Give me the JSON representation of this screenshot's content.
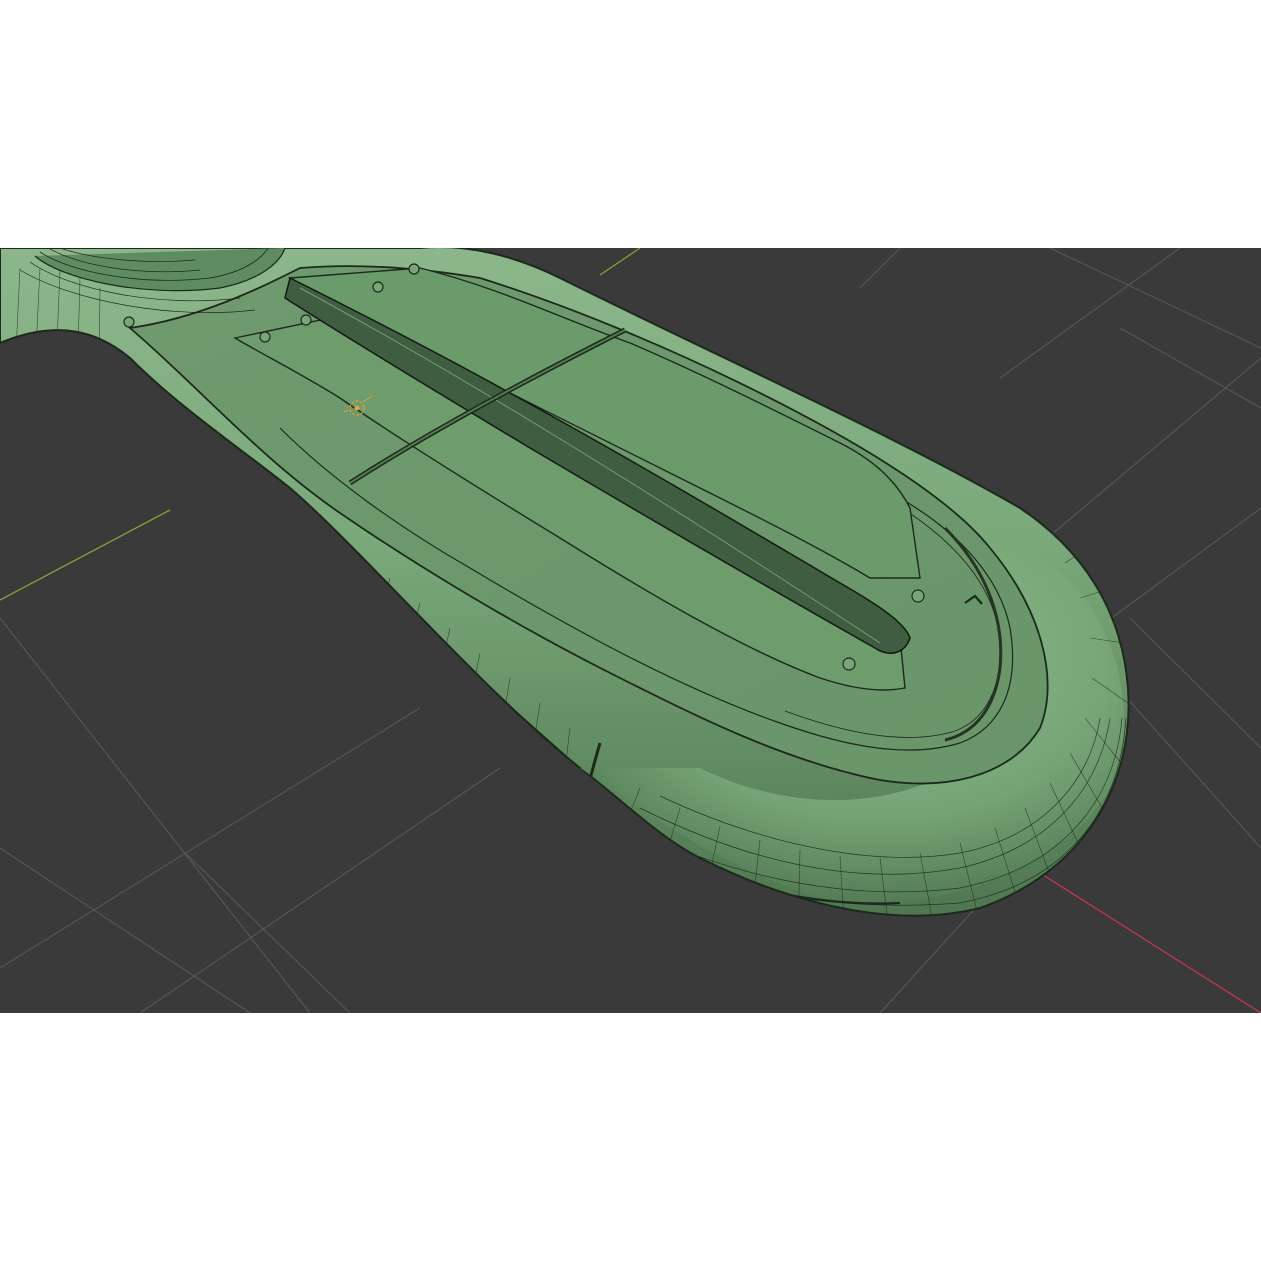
{
  "viewport": {
    "background": "#3a3a3a",
    "grid_color": "#575757",
    "x_axis_color": "#c0394a",
    "y_axis_color": "#7fa33a"
  },
  "mesh": {
    "fill_color": "#6d9a6d",
    "highlight_color": "#8cb78b",
    "shadow_color": "#4f7650",
    "wire_color": "#1b2a1b",
    "display_mode": "wireframe-overlay"
  },
  "origin_marker": {
    "icon": "object-origin-icon",
    "color": "#e8a33b"
  }
}
